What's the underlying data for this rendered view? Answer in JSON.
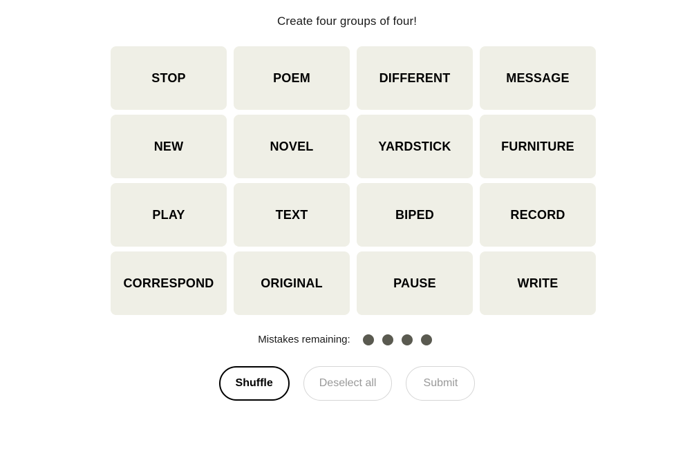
{
  "header": {
    "instruction": "Create four groups of four!"
  },
  "board": {
    "rows": [
      {
        "tiles": [
          {
            "word": "STOP"
          },
          {
            "word": "POEM"
          },
          {
            "word": "DIFFERENT"
          },
          {
            "word": "MESSAGE"
          }
        ]
      },
      {
        "tiles": [
          {
            "word": "NEW"
          },
          {
            "word": "NOVEL"
          },
          {
            "word": "YARDSTICK"
          },
          {
            "word": "FURNITURE"
          }
        ]
      },
      {
        "tiles": [
          {
            "word": "PLAY"
          },
          {
            "word": "TEXT"
          },
          {
            "word": "BIPED"
          },
          {
            "word": "RECORD"
          }
        ]
      },
      {
        "tiles": [
          {
            "word": "CORRESPOND"
          },
          {
            "word": "ORIGINAL"
          },
          {
            "word": "PAUSE"
          },
          {
            "word": "WRITE"
          }
        ]
      }
    ],
    "tile_background_color": "#EFEFE6",
    "tile_text_color": "#000000"
  },
  "mistakes": {
    "label": "Mistakes remaining:",
    "count": 4,
    "dot_color": "#5A5A50"
  },
  "actions": {
    "shuffle_label": "Shuffle",
    "deselect_label": "Deselect all",
    "submit_label": "Submit",
    "shuffle_enabled": true,
    "deselect_enabled": false,
    "submit_enabled": false
  },
  "colors": {
    "page_background": "#FFFFFF",
    "text_primary": "#1A1A1A",
    "text_disabled": "#999999",
    "border_disabled": "#D6D6D6"
  }
}
